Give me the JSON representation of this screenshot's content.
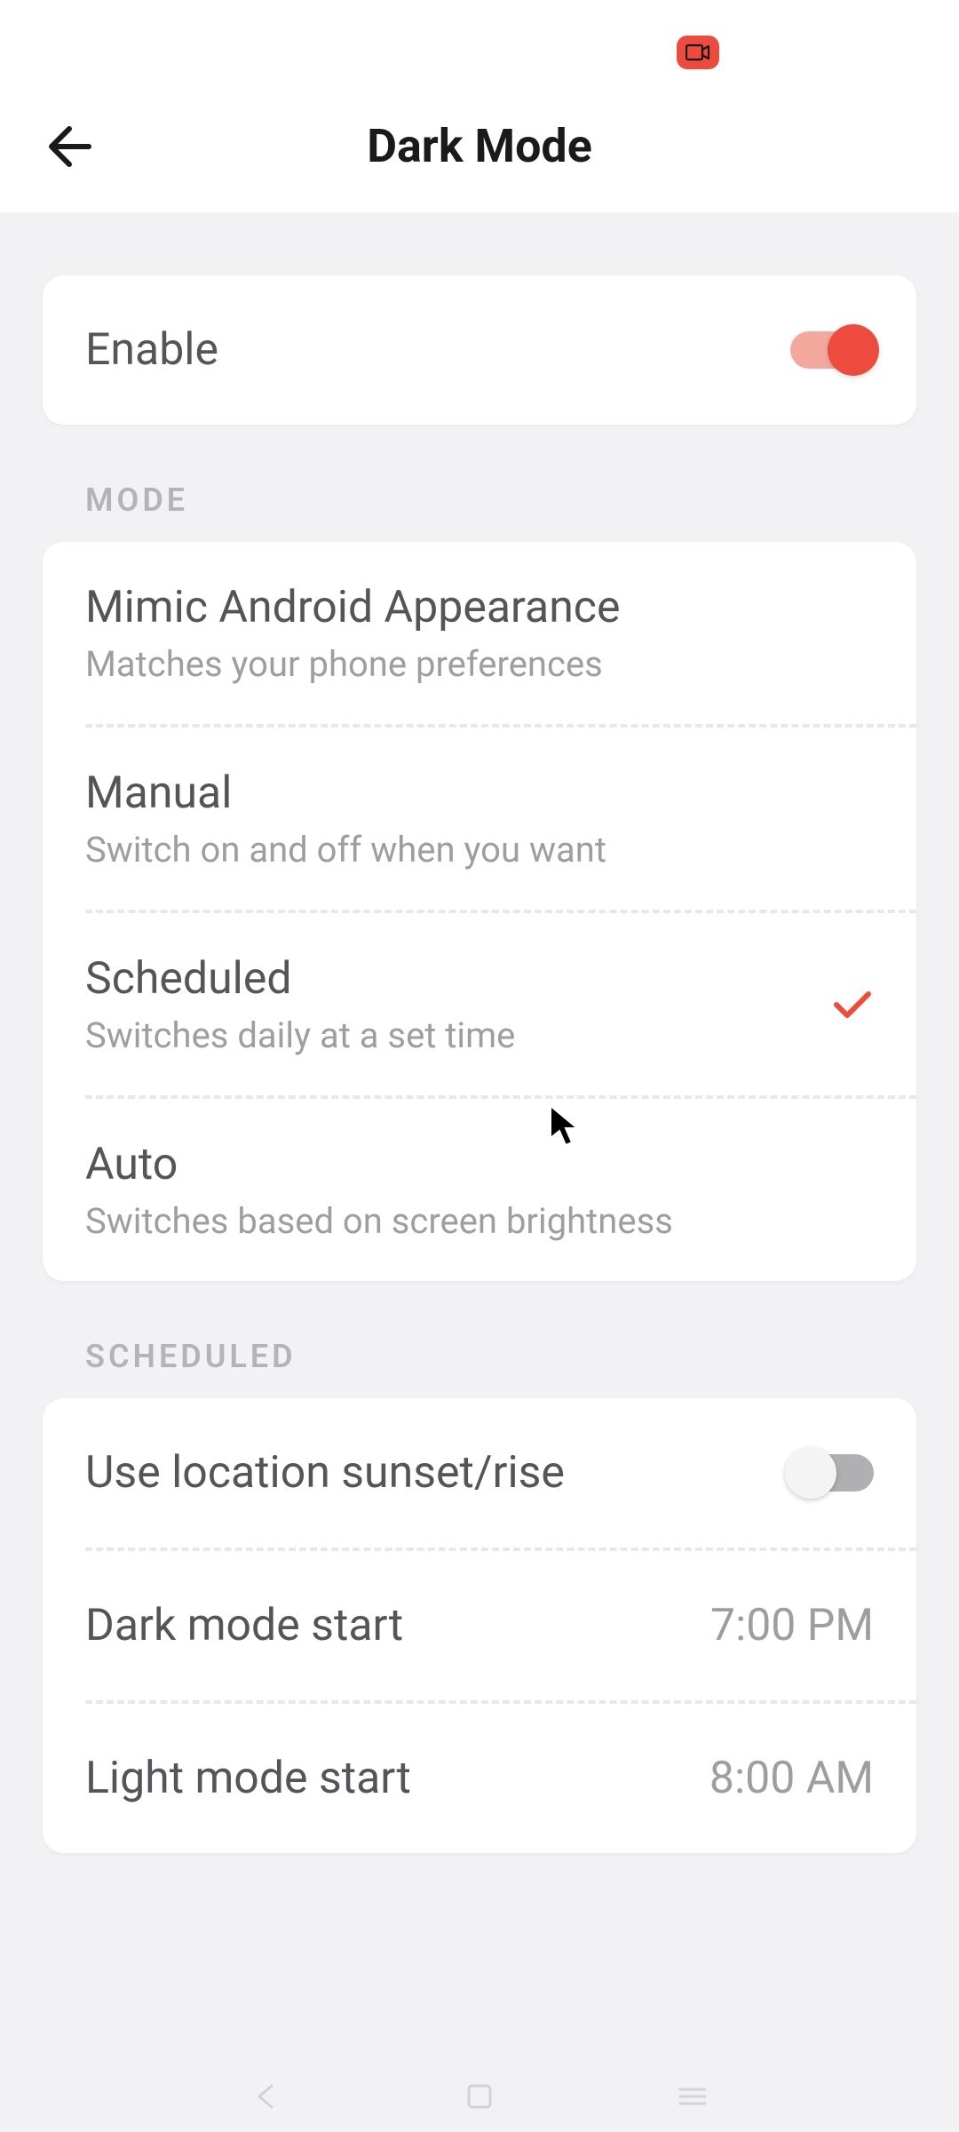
{
  "header": {
    "title": "Dark Mode"
  },
  "enable": {
    "label": "Enable",
    "state": true
  },
  "sections": {
    "mode": {
      "header": "MODE",
      "items": [
        {
          "title": "Mimic Android Appearance",
          "subtitle": "Matches your phone preferences",
          "selected": false
        },
        {
          "title": "Manual",
          "subtitle": "Switch on and off when you want",
          "selected": false
        },
        {
          "title": "Scheduled",
          "subtitle": "Switches daily at a set time",
          "selected": true
        },
        {
          "title": "Auto",
          "subtitle": "Switches based on screen brightness",
          "selected": false
        }
      ]
    },
    "scheduled": {
      "header": "SCHEDULED",
      "location_toggle": {
        "label": "Use location sunset/rise",
        "state": false
      },
      "dark_start": {
        "label": "Dark mode start",
        "value": "7:00 PM"
      },
      "light_start": {
        "label": "Light mode start",
        "value": "8:00 AM"
      }
    }
  }
}
